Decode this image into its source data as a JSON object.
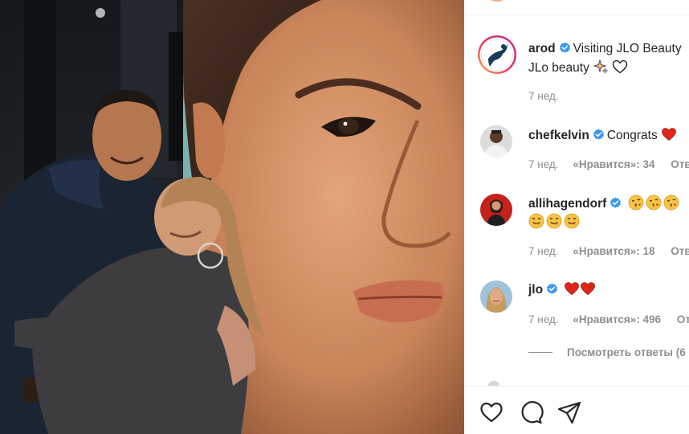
{
  "post": {
    "username": "arod",
    "caption_line1": "Visiting JLO Beauty",
    "caption_line2": "JLo beauty",
    "age": "7 нед."
  },
  "comments": [
    {
      "username": "chefkelvin",
      "text": "Congrats",
      "age": "7 нед.",
      "likes": "«Нравится»: 34",
      "reply": "Ответить"
    },
    {
      "username": "allihagendorf",
      "age": "7 нед.",
      "likes": "«Нравится»: 18",
      "reply": "Ответить"
    },
    {
      "username": "jlo",
      "age": "7 нед.",
      "likes": "«Нравится»: 496",
      "reply": "Ответить",
      "view_replies": "Посмотреть ответы (6"
    }
  ],
  "icons": {
    "verified": "verified-badge-icon",
    "like": "heart-outline-icon",
    "comment": "speech-bubble-icon",
    "share": "paper-plane-icon"
  },
  "colors": {
    "verified_blue": "#3897f0",
    "muted_text": "#8e8e8e",
    "heart_red": "#e0251b"
  }
}
